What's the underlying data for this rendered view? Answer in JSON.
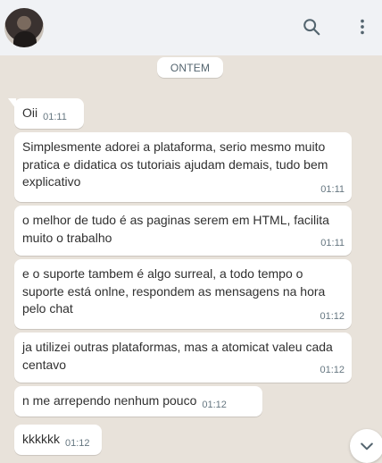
{
  "header": {
    "avatar": "contact-avatar",
    "icons": [
      "search-icon",
      "more-vertical-icon"
    ]
  },
  "date_separator": "ONTEM",
  "messages": [
    {
      "text": "Oii",
      "time": "01:11"
    },
    {
      "text": "Simplesmente adorei a plataforma, serio mesmo muito pratica e didatica os tutoriais ajudam demais, tudo bem explicativo",
      "time": "01:11"
    },
    {
      "text": "o melhor de tudo é as paginas serem em HTML, facilita muito o trabalho",
      "time": "01:11"
    },
    {
      "text": "e o suporte tambem é algo surreal, a todo tempo o suporte está onlne, respondem as mensagens na hora pelo chat",
      "time": "01:12"
    },
    {
      "text": "ja utilizei outras plataformas, mas a atomicat valeu cada centavo",
      "time": "01:12"
    },
    {
      "text": "n me arrependo nenhum pouco",
      "time": "01:12"
    },
    {
      "text": "kkkkkk",
      "time": "01:12"
    }
  ],
  "scroll_button_icon": "chevron-down-icon",
  "colors": {
    "header_bg": "#f0f2f5",
    "chat_bg": "#e8e2da",
    "bubble_bg": "#ffffff",
    "timestamp": "#667781",
    "icon": "#54656f"
  }
}
